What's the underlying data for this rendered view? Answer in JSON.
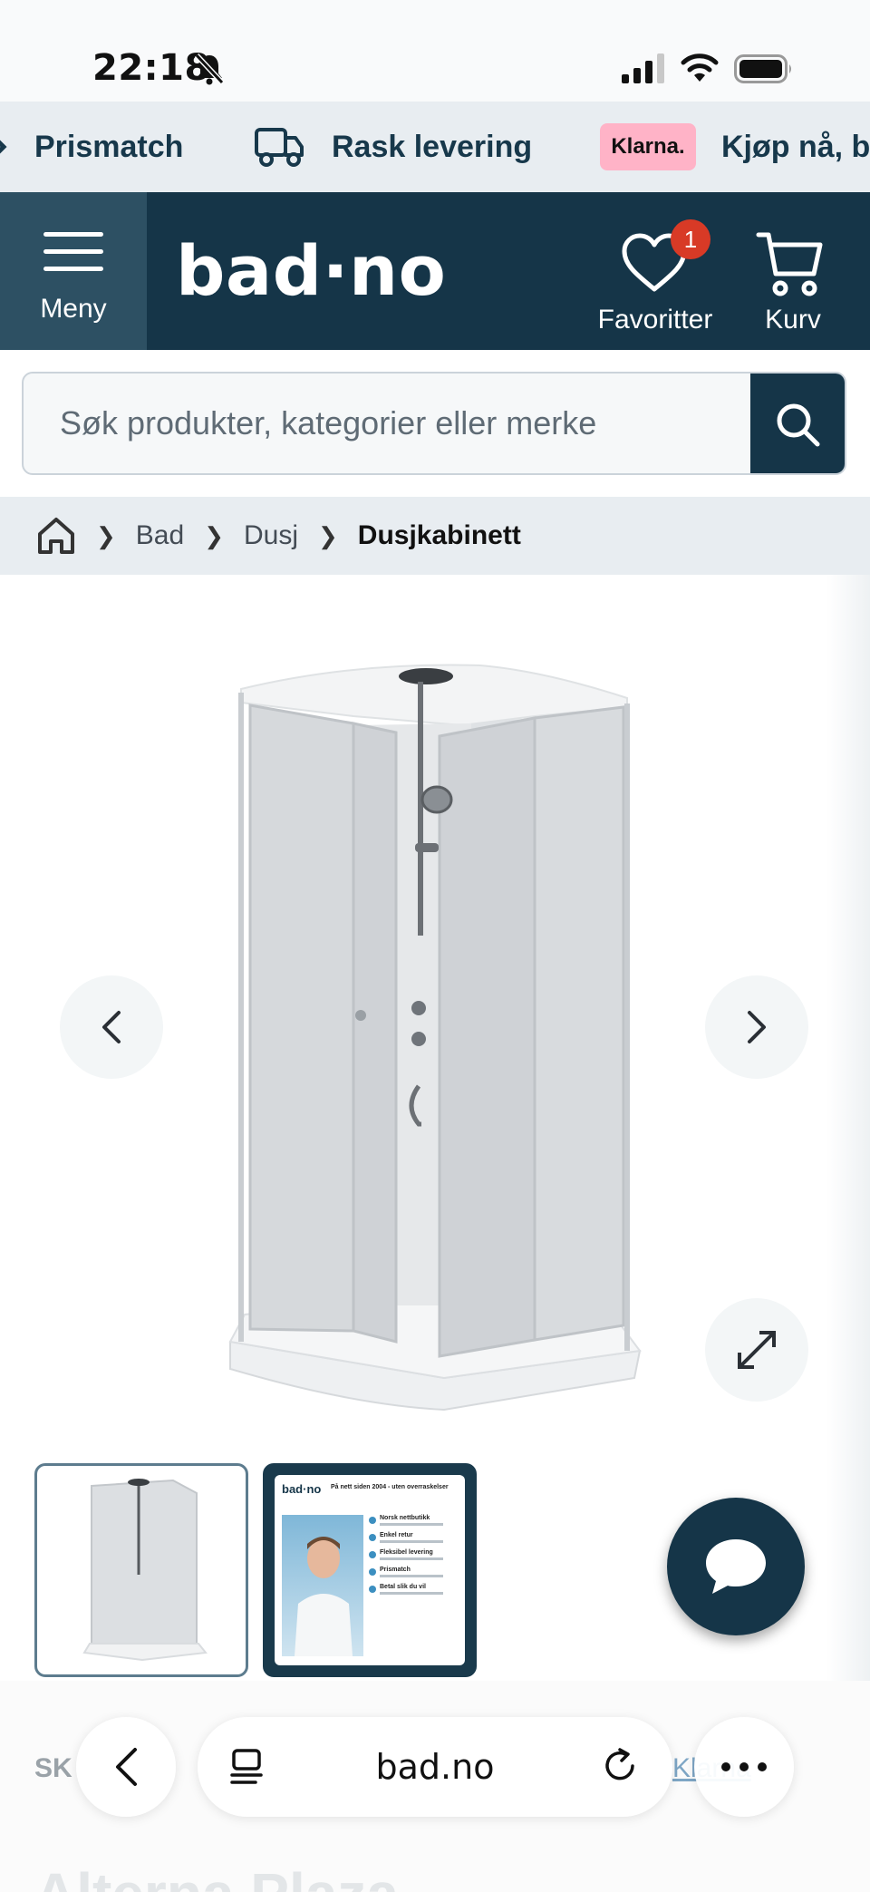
{
  "status_bar": {
    "time": "22:18"
  },
  "usp": {
    "items": [
      "Prismatch",
      "Rask levering",
      "Kjøp nå, betal senere"
    ],
    "klarna_label": "Klarna."
  },
  "header": {
    "menu_label": "Meny",
    "logo": "bad·no",
    "favorites_label": "Favoritter",
    "favorites_count": "1",
    "cart_label": "Kurv"
  },
  "search": {
    "placeholder": "Søk produkter, kategorier eller merke"
  },
  "breadcrumb": {
    "items": [
      "Bad",
      "Dusj",
      "Dusjkabinett"
    ]
  },
  "thumbnail_2": {
    "brand": "bad·no",
    "tagline": "På nett siden 2004 - uten overraskelser",
    "points": [
      "Norsk nettbutikk",
      "Enkel retur",
      "Fleksibel levering",
      "Prismatch",
      "Betal slik du vil"
    ]
  },
  "below_fold": {
    "sku_prefix": "SK",
    "link_partial": "Klarna",
    "title_partial": "Alterna Plaza"
  },
  "browser": {
    "domain": "bad.no"
  },
  "colors": {
    "brand_dark": "#153548",
    "menu_bg": "#2d5063",
    "badge": "#d83a26",
    "klarna": "#ffb3c7",
    "strip_bg": "#e8edf1"
  },
  "icons": [
    "bell-slash-icon",
    "signal-icon",
    "wifi-icon",
    "battery-icon",
    "check-icon",
    "truck-icon",
    "hamburger-icon",
    "heart-icon",
    "cart-icon",
    "search-icon",
    "home-icon",
    "chevron-left-icon",
    "chevron-right-icon",
    "expand-icon",
    "chat-icon",
    "tabs-icon",
    "reload-icon",
    "more-icon"
  ]
}
